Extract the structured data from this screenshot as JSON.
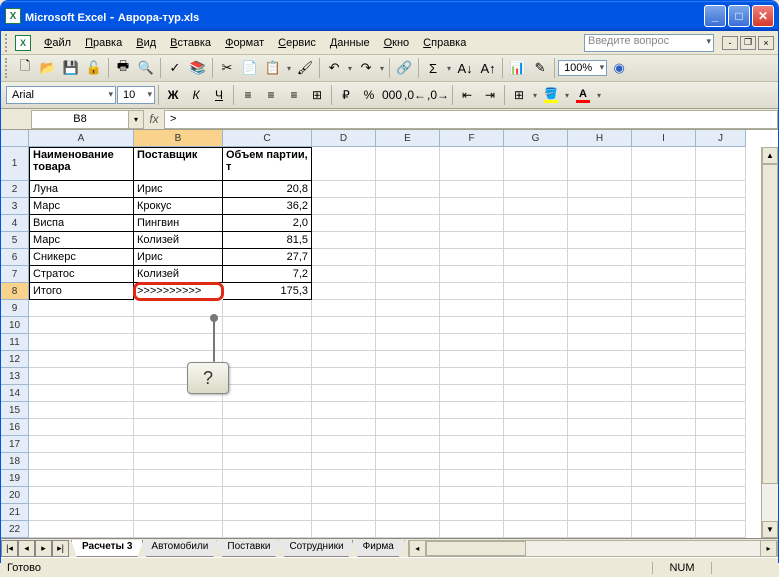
{
  "title": {
    "app": "Microsoft Excel",
    "doc": "Аврора-тур.xls"
  },
  "menu": [
    "Файл",
    "Правка",
    "Вид",
    "Вставка",
    "Формат",
    "Сервис",
    "Данные",
    "Окно",
    "Справка"
  ],
  "search_placeholder": "Введите вопрос",
  "zoom": "100%",
  "font": {
    "name": "Arial",
    "size": "10"
  },
  "namebox": "B8",
  "formula": ">",
  "callout": "?",
  "columns": [
    "A",
    "B",
    "C",
    "D",
    "E",
    "F",
    "G",
    "H",
    "I",
    "J"
  ],
  "rows_shown": 22,
  "active": {
    "row": 8,
    "col": "B"
  },
  "headers": {
    "A": "Наименование товара",
    "B": "Поставщик",
    "C": "Объем партии, т"
  },
  "data": [
    {
      "A": "Луна",
      "B": "Ирис",
      "C": "20,8"
    },
    {
      "A": "Марс",
      "B": "Крокус",
      "C": "36,2"
    },
    {
      "A": "Виспа",
      "B": "Пингвин",
      "C": "2,0"
    },
    {
      "A": "Марс",
      "B": "Колизей",
      "C": "81,5"
    },
    {
      "A": "Сникерс",
      "B": "Ирис",
      "C": "27,7"
    },
    {
      "A": "Стратос",
      "B": "Колизей",
      "C": "7,2"
    },
    {
      "A": "Итого",
      "B": ">>>>>>>>>>",
      "C": "175,3"
    }
  ],
  "tabs": [
    "Расчеты 3",
    "Автомобили",
    "Поставки",
    "Сотрудники",
    "Фирма"
  ],
  "active_tab": 0,
  "status": {
    "ready": "Готово",
    "num": "NUM"
  }
}
